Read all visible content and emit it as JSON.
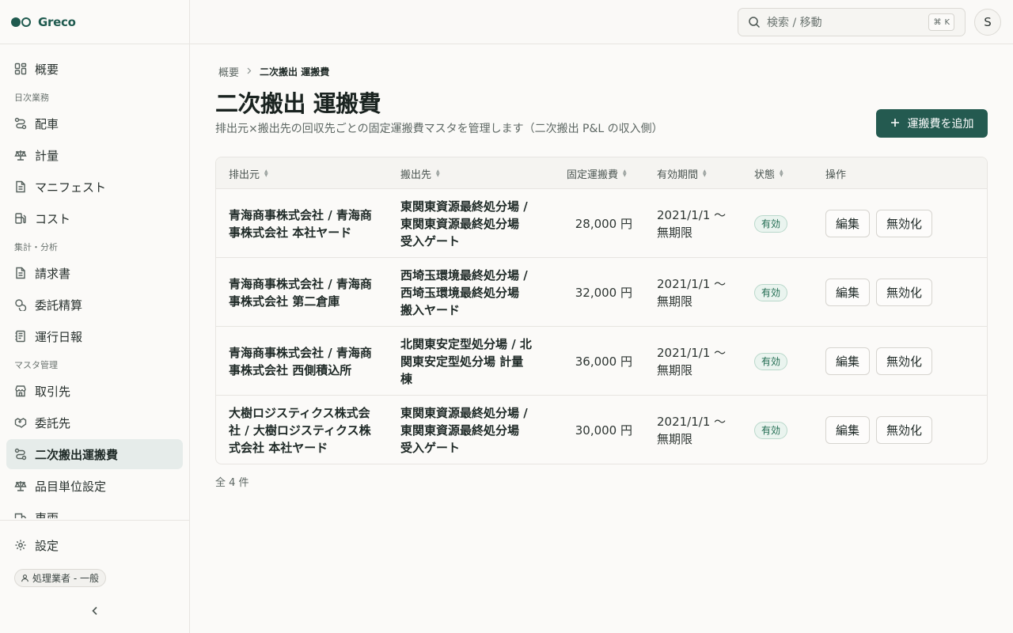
{
  "brand": {
    "name": "Greco"
  },
  "sidebar": {
    "items": [
      {
        "type": "item",
        "label": "概要",
        "icon": "dashboard-icon"
      },
      {
        "type": "section",
        "label": "日次業務"
      },
      {
        "type": "item",
        "label": "配車",
        "icon": "route-icon"
      },
      {
        "type": "item",
        "label": "計量",
        "icon": "scale-icon"
      },
      {
        "type": "item",
        "label": "マニフェスト",
        "icon": "document-icon"
      },
      {
        "type": "item",
        "label": "コスト",
        "icon": "fuel-icon"
      },
      {
        "type": "section",
        "label": "集計・分析"
      },
      {
        "type": "item",
        "label": "請求書",
        "icon": "document-icon"
      },
      {
        "type": "item",
        "label": "委託精算",
        "icon": "coins-icon"
      },
      {
        "type": "item",
        "label": "運行日報",
        "icon": "report-icon"
      },
      {
        "type": "section",
        "label": "マスタ管理"
      },
      {
        "type": "item",
        "label": "取引先",
        "icon": "store-icon"
      },
      {
        "type": "item",
        "label": "委託先",
        "icon": "handshake-icon"
      },
      {
        "type": "item",
        "label": "二次搬出運搬費",
        "icon": "route-icon",
        "active": true
      },
      {
        "type": "item",
        "label": "品目単位設定",
        "icon": "scale-icon"
      },
      {
        "type": "item",
        "label": "車両",
        "icon": "truck-icon"
      }
    ],
    "settings_label": "設定",
    "role_label": "処理業者 - 一般"
  },
  "topbar": {
    "search_placeholder": "検索 / 移動",
    "shortcut_mod": "⌘",
    "shortcut_key": "K",
    "avatar_initial": "S"
  },
  "breadcrumb": {
    "root": "概要",
    "current": "二次搬出 運搬費"
  },
  "page": {
    "title": "二次搬出 運搬費",
    "subtitle": "排出元×搬出先の回収先ごとの固定運搬費マスタを管理します（二次搬出 P&L の収入側）",
    "add_button": "運搬費を追加"
  },
  "table": {
    "headers": {
      "origin": "排出元",
      "destination": "搬出先",
      "fee": "固定運搬費",
      "period": "有効期間",
      "status": "状態",
      "actions": "操作"
    },
    "rows": [
      {
        "origin": "青海商事株式会社 / 青海商事株式会社 本社ヤード",
        "destination": "東関東資源最終処分場 / 東関東資源最終処分場 受入ゲート",
        "fee": "28,000 円",
        "period": "2021/1/1 〜 無期限",
        "status": "有効"
      },
      {
        "origin": "青海商事株式会社 / 青海商事株式会社 第二倉庫",
        "destination": "西埼玉環境最終処分場 / 西埼玉環境最終処分場 搬入ヤード",
        "fee": "32,000 円",
        "period": "2021/1/1 〜 無期限",
        "status": "有効"
      },
      {
        "origin": "青海商事株式会社 / 青海商事株式会社 西側積込所",
        "destination": "北関東安定型処分場 / 北関東安定型処分場 計量棟",
        "fee": "36,000 円",
        "period": "2021/1/1 〜 無期限",
        "status": "有効"
      },
      {
        "origin": "大樹ロジスティクス株式会社 / 大樹ロジスティクス株式会社 本社ヤード",
        "destination": "東関東資源最終処分場 / 東関東資源最終処分場 受入ゲート",
        "fee": "30,000 円",
        "period": "2021/1/1 〜 無期限",
        "status": "有効"
      }
    ],
    "edit_label": "編集",
    "disable_label": "無効化",
    "total": "全 4 件"
  }
}
